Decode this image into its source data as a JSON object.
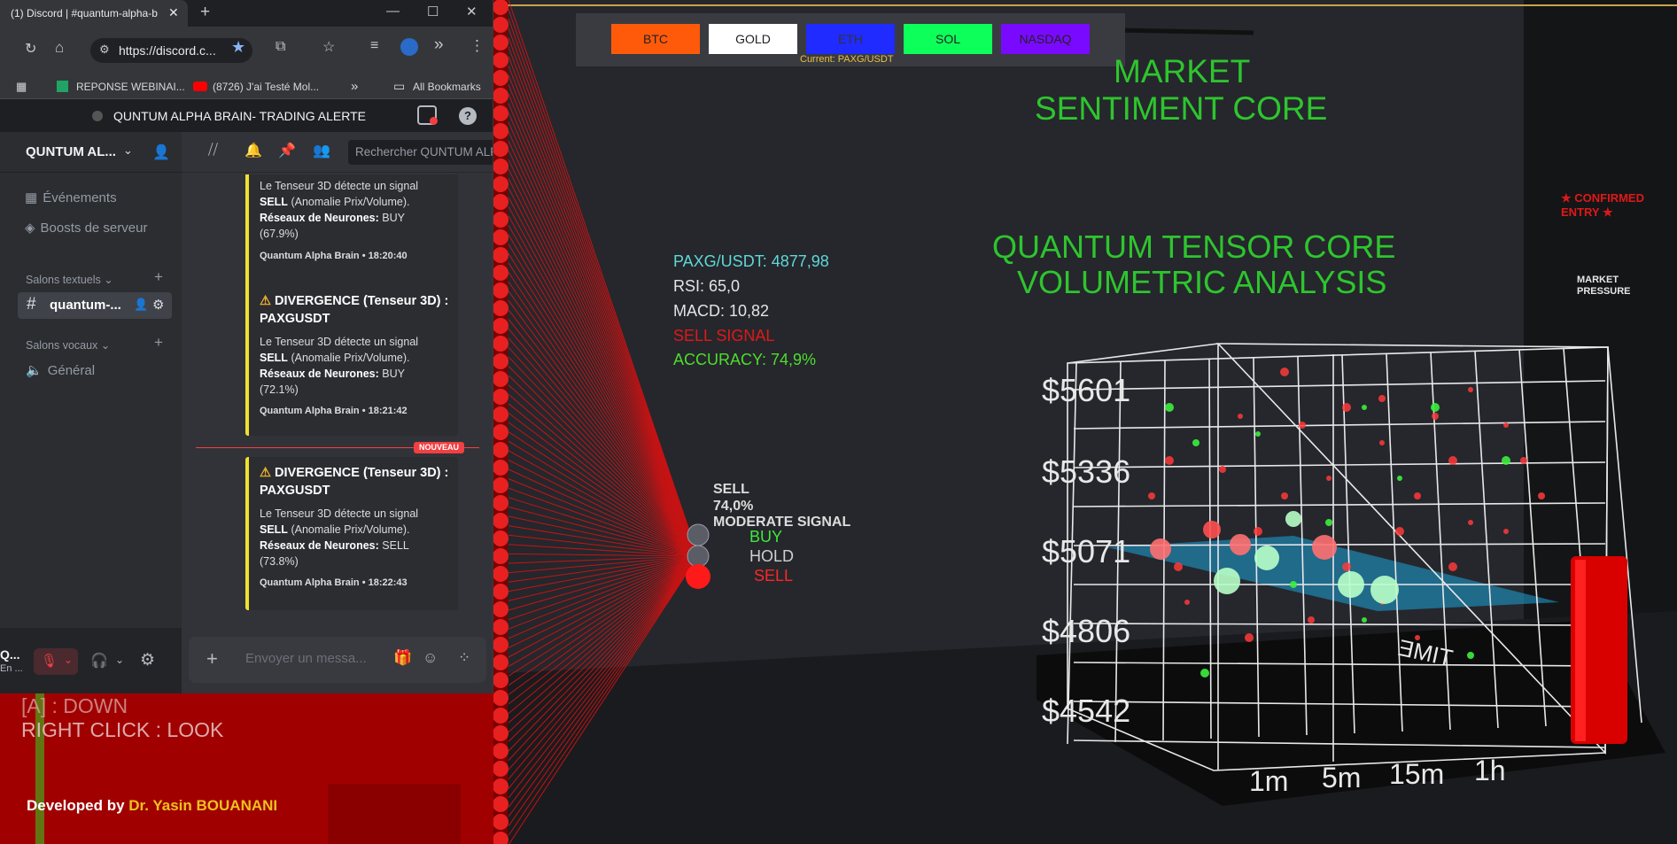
{
  "browser": {
    "tab_title": "(1) Discord | #quantum-alpha-b",
    "url": "https://discord.c...",
    "bookmarks": [
      "REPONSE WEBINAI...",
      "(8726) J'ai Testé Mol...",
      "All Bookmarks"
    ],
    "more_glyph": "»",
    "new_tab_glyph": "+"
  },
  "discord": {
    "window_title": "QUNTUM ALPHA BRAIN- TRADING ALERTE",
    "server_name": "QUNTUM AL...",
    "events_label": "Événements",
    "boosts_label": "Boosts de serveur",
    "text_channels_header": "Salons textuels",
    "channel_name": "quantum-...",
    "voice_channels_header": "Salons vocaux",
    "voice_channel": "Général",
    "search_placeholder": "Rechercher QUNTUM ALP",
    "new_badge": "NOUVEAU",
    "message_placeholder": "Envoyer un messa...",
    "user_short": "Q...",
    "user_status": "En ...",
    "alerts": [
      {
        "title": "",
        "line1": "Le Tenseur 3D détecte un signal",
        "signal": "SELL",
        "signal_note": "(Anomalie Prix/Volume).",
        "nn_label": "Réseaux de Neurones:",
        "nn_value": "BUY",
        "nn_pct": "(67.9%)",
        "footer": "Quantum Alpha Brain • 18:20:40"
      },
      {
        "title": "DIVERGENCE (Tenseur 3D) : PAXGUSDT",
        "line1": "Le Tenseur 3D détecte un signal",
        "signal": "SELL",
        "signal_note": "(Anomalie Prix/Volume).",
        "nn_label": "Réseaux de Neurones:",
        "nn_value": "BUY",
        "nn_pct": "(72.1%)",
        "footer": "Quantum Alpha Brain • 18:21:42"
      },
      {
        "title": "DIVERGENCE (Tenseur 3D) : PAXGUSDT",
        "line1": "Le Tenseur 3D détecte un signal",
        "signal": "SELL",
        "signal_note": "(Anomalie Prix/Volume).",
        "nn_label": "Réseaux de Neurones:",
        "nn_value": "SELL",
        "nn_pct": "(73.8%)",
        "footer": "Quantum Alpha Brain • 18:22:43"
      }
    ]
  },
  "assets": {
    "buttons": [
      {
        "label": "BTC",
        "color": "#ff5a0a",
        "text_color": "#222222"
      },
      {
        "label": "GOLD",
        "color": "#ffffff",
        "text_color": "#222222"
      },
      {
        "label": "ETH",
        "color": "#1f2bff",
        "text_color": "#333333"
      },
      {
        "label": "SOL",
        "color": "#0dff5a",
        "text_color": "#222222"
      },
      {
        "label": "NASDAQ",
        "color": "#7a0aff",
        "text_color": "#222222"
      }
    ],
    "current": "Current: PAXG/USDT"
  },
  "hud": {
    "pair_price": "PAXG/USDT: 4877,98",
    "rsi": "RSI: 65,0",
    "macd": "MACD: 10,82",
    "signal": "SELL SIGNAL",
    "accuracy": "ACCURACY: 74,9%"
  },
  "neural": {
    "sell_label": "SELL",
    "sell_pct": "74,0%",
    "strength": "MODERATE SIGNAL",
    "buy": "BUY",
    "hold": "HOLD",
    "sell": "SELL"
  },
  "titles": {
    "sentiment_l1": "MARKET",
    "sentiment_l2": "SENTIMENT CORE",
    "tensor_l1": "QUANTUM TENSOR CORE",
    "tensor_l2": "VOLUMETRIC ANALYSIS"
  },
  "confirmed_l1": "★ CONFIRMED",
  "confirmed_l2": "ENTRY ★",
  "market_pressure_l1": "MARKET",
  "market_pressure_l2": "PRESSURE",
  "cube": {
    "price_labels": [
      "$5601",
      "$5336",
      "$5071",
      "$4806",
      "$4542"
    ],
    "time_labels": [
      "1m",
      "5m",
      "15m",
      "1h"
    ],
    "time_axis": "TIME"
  },
  "controls": {
    "down_hint": "[A] : DOWN",
    "look_hint": "RIGHT CLICK : LOOK"
  },
  "credits": {
    "prefix": "Developed by",
    "author": "Dr. Yasin BOUANANI"
  }
}
